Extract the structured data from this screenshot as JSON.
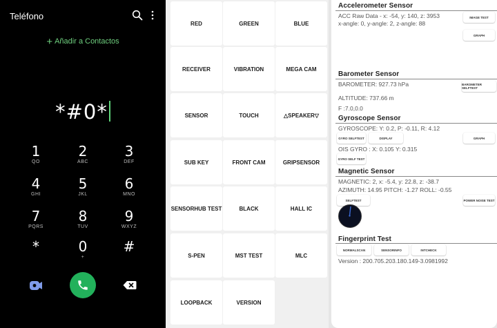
{
  "dialer": {
    "title": "Teléfono",
    "add_contact": "Añadir a Contactos",
    "digits": "*#0*",
    "keys": [
      {
        "num": "1",
        "sub": "QO"
      },
      {
        "num": "2",
        "sub": "ABC"
      },
      {
        "num": "3",
        "sub": "DEF"
      },
      {
        "num": "4",
        "sub": "GHI"
      },
      {
        "num": "5",
        "sub": "JKL"
      },
      {
        "num": "6",
        "sub": "MNO"
      },
      {
        "num": "7",
        "sub": "PQRS"
      },
      {
        "num": "8",
        "sub": "TUV"
      },
      {
        "num": "9",
        "sub": "WXYZ"
      },
      {
        "num": "*",
        "sub": ""
      },
      {
        "num": "0",
        "sub": "+"
      },
      {
        "num": "#",
        "sub": ""
      }
    ],
    "icons": {
      "search": "search-icon",
      "more": "more-vert-icon",
      "video": "video-call-icon",
      "call": "phone-icon",
      "backspace": "backspace-icon"
    },
    "accent_color": "#6fd07f",
    "call_color": "#22b15b"
  },
  "test_menu": {
    "tiles": [
      "RED",
      "GREEN",
      "BLUE",
      "RECEIVER",
      "VIBRATION",
      "MEGA CAM",
      "SENSOR",
      "TOUCH",
      "△SPEAKER▽",
      "SUB KEY",
      "FRONT CAM",
      "GRIPSENSOR",
      "SENSORHUB TEST",
      "BLACK",
      "HALL IC",
      "S-PEN",
      "MST TEST",
      "MLC",
      "LOOPBACK",
      "VERSION"
    ]
  },
  "sensors": {
    "accelerometer": {
      "title": "Accelerometer Sensor",
      "raw": "ACC Raw Data - x: -54, y: 140, z: 3953",
      "angles": "x-angle: 0, y-angle: 2, z-angle: 88",
      "image_test": "IMAGE TEST",
      "graph": "GRAPH"
    },
    "barometer": {
      "title": "Barometer Sensor",
      "value": "BAROMETER: 927.73 hPa",
      "selftest": "BAROMETER SELFTEST",
      "altitude": "ALTITUDE: 737.66 m",
      "f": "F :7.0,0.0"
    },
    "gyroscope": {
      "title": "Gyroscope Sensor",
      "value": "GYROSCOPE: Y: 0.2, P: -0.11, R: 4.12",
      "selftest": "GYRO SELFTEST",
      "display": "DISPLAY",
      "graph": "GRAPH",
      "ois": "OIS GYRO : X: 0.105 Y: 0.315",
      "self_test": "GYRO SELF TEST"
    },
    "magnetic": {
      "title": "Magnetic Sensor",
      "value": "MAGNETIC: 2, x: -5.4, y: 22.8, z: -38.7",
      "azimuth": "AZIMUTH: 14.95   PITCH: -1.27   ROLL: -0.55",
      "selftest": "SELFTEST",
      "power_noise": "POWER NOISE TEST"
    },
    "fingerprint": {
      "title": "Fingerprint Test",
      "normalscan": "NORMALSCAN",
      "sensorinfo": "SENSORINFO",
      "intcheck": "INTCHECK",
      "version": "Version : 200.705.203.180.149-3.0981992"
    }
  }
}
